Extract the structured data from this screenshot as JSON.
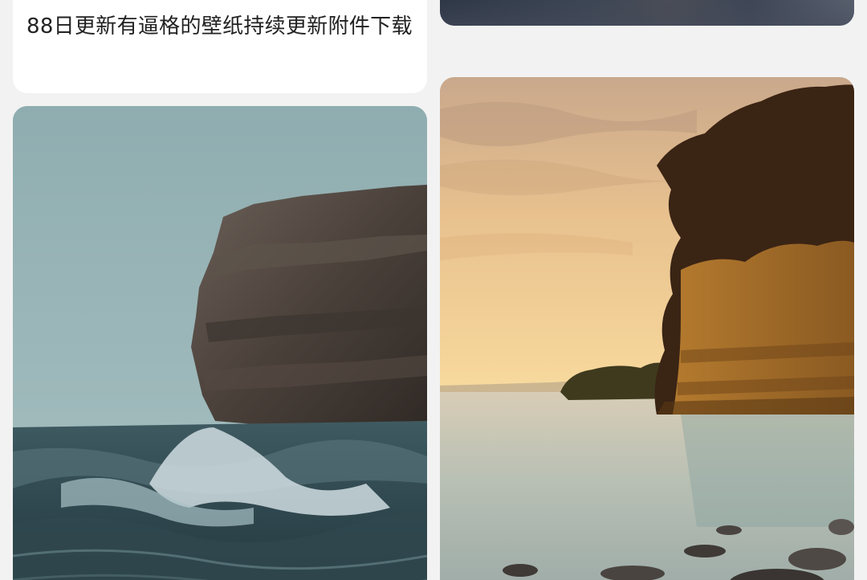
{
  "feed": {
    "left_column": {
      "caption_card": {
        "text": "88日更新有逼格的壁纸持续更新附件下载"
      },
      "image_card": {
        "subject": "sea-cliff-waves"
      }
    },
    "right_column": {
      "strip_card": {
        "subject": "dusk-landscape"
      },
      "image_card": {
        "subject": "sunset-coast"
      }
    }
  },
  "colors": {
    "background": "#f2f2f2",
    "card": "#ffffff",
    "caption_text": "#222222"
  }
}
